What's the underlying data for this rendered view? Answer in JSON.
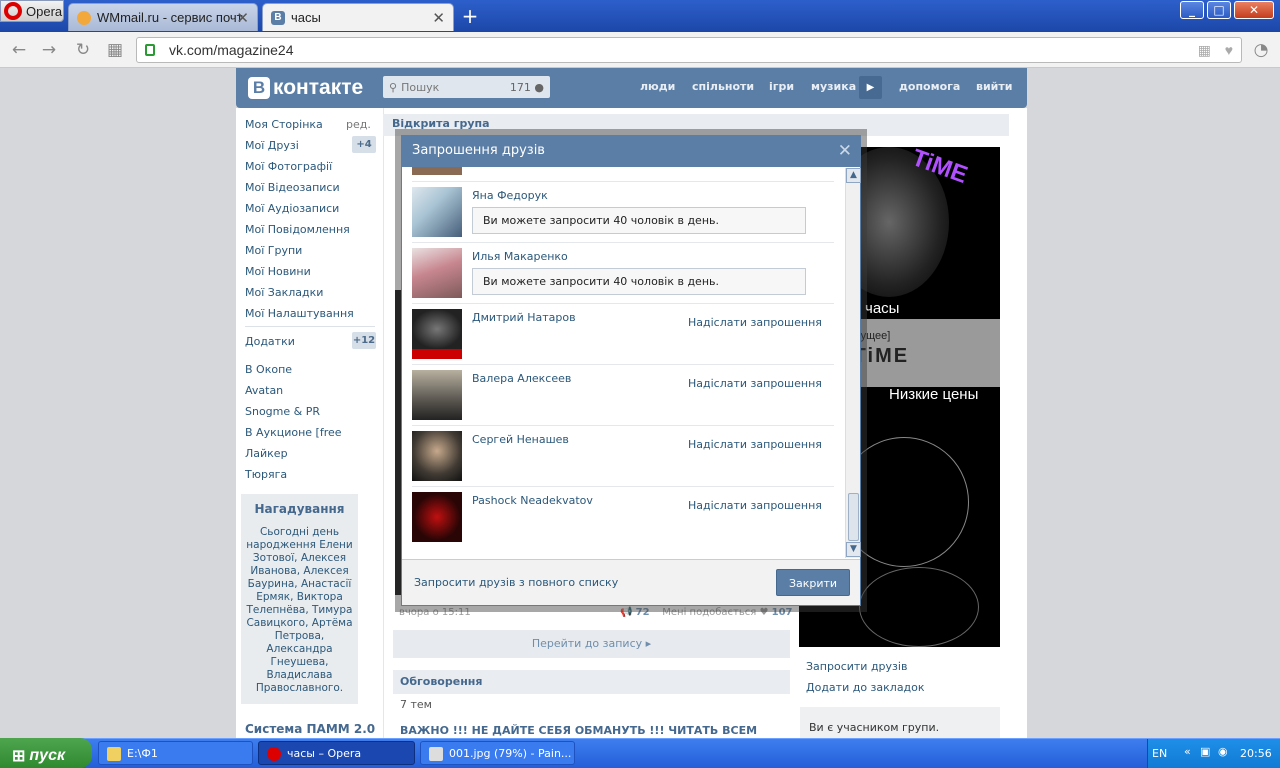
{
  "browser": {
    "menu_label": "Opera",
    "tabs": [
      {
        "label": "WMmail.ru - сервис почт"
      },
      {
        "label": "часы",
        "favicon": "В"
      }
    ],
    "new_tab": "+",
    "address": "vk.com/magazine24",
    "window_buttons": [
      "_",
      "□",
      "✕"
    ]
  },
  "vk": {
    "logo_text": "контакте",
    "logo_letter": "В",
    "search_placeholder": "Пошук",
    "search_count": "171",
    "top_links": [
      "люди",
      "спільноти",
      "ігри",
      "музика",
      "допомога",
      "вийти"
    ],
    "sidebar": {
      "items": [
        {
          "label": "Моя Сторінка",
          "extra": "ред."
        },
        {
          "label": "Мої Друзі",
          "badge": "+4"
        },
        {
          "label": "Мої Фотографії"
        },
        {
          "label": "Мої Відеозаписи"
        },
        {
          "label": "Мої Аудіозаписи"
        },
        {
          "label": "Мої Повідомлення"
        },
        {
          "label": "Мої Групи"
        },
        {
          "label": "Мої Новини"
        },
        {
          "label": "Мої Закладки"
        },
        {
          "label": "Мої Налаштування"
        },
        {
          "label": "Додатки",
          "badge": "+12"
        },
        {
          "label": "В Окопе"
        },
        {
          "label": "Avatan"
        },
        {
          "label": "Snogme & PR"
        },
        {
          "label": "В Аукционе [free"
        },
        {
          "label": "Лайкер"
        },
        {
          "label": "Тюряга"
        }
      ],
      "reminder_title": "Нагадування",
      "reminder_text": "Сьогодні день народження Елени Зотової, Алексея Иванова, Алексея Баурина, Анастасії Ермяк, Виктора Телепнёва, Тимура Савицкого, Артёма Петрова, Александра Гнеушева, Владислава Православного.",
      "pamm": "Система ПАММ 2.0"
    },
    "group_type": "Відкрита група",
    "post": {
      "time": "вчора о 15:11",
      "shares": "72",
      "likes_label": "Мені подобається",
      "likes": "107",
      "goto_label": "Перейти до запису ▸"
    },
    "discussions": {
      "title": "Обговорення",
      "count": "7 тем",
      "topic": "ВАЖНО !!! НЕ ДАЙТЕ СЕБЯ ОБМАНУТЬ !!! ЧИТАТЬ ВСЕМ"
    },
    "ad": {
      "line1": "часы",
      "line2": "будущее]",
      "line3": "RLD TiME",
      "line4": "Низкие цены",
      "logo": "TiME"
    },
    "right_links": {
      "invite": "Запросити друзів",
      "bookmark": "Додати до закладок",
      "member": "Ви є учасником групи."
    }
  },
  "dialog": {
    "title": "Запрошення друзів",
    "close_icon": "✕",
    "friends": [
      {
        "name": "Яна Федорук",
        "status": "Ви можете запросити 40 чоловік в день.",
        "avatar_color": "#a9c4d4"
      },
      {
        "name": "Илья Макаренко",
        "status": "Ви можете запросити 40 чоловік в день.",
        "avatar_color": "#c7868f"
      },
      {
        "name": "Дмитрий Натаров",
        "action": "Надіслати запрошення",
        "avatar_color": "#3a3a3a"
      },
      {
        "name": "Валера Алексеев",
        "action": "Надіслати запрошення",
        "avatar_color": "#7d7a70"
      },
      {
        "name": "Сергей Ненашев",
        "action": "Надіслати запрошення",
        "avatar_color": "#403a33"
      },
      {
        "name": "Pashock Neadekvatov",
        "action": "Надіслати запрошення",
        "avatar_color": "#2a0505"
      }
    ],
    "full_list_link": "Запросити друзів з повного списку",
    "close_button": "Закрити"
  },
  "taskbar": {
    "start_label": "пуск",
    "tasks": [
      {
        "label": "E:\\Ф1"
      },
      {
        "label": "часы – Opera"
      },
      {
        "label": "001.jpg (79%) - Pain..."
      }
    ],
    "lang": "EN",
    "clock": "20:56"
  }
}
